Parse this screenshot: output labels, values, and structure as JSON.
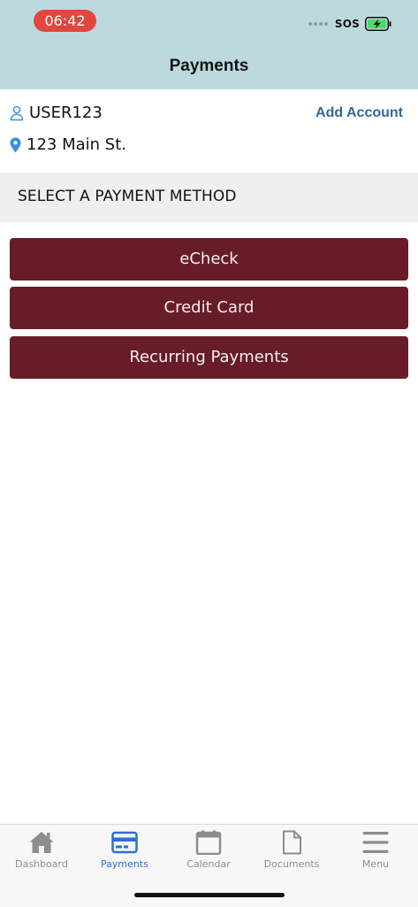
{
  "status_bar": {
    "time": "06:42",
    "carrier": "SOS"
  },
  "header": {
    "title": "Payments"
  },
  "account": {
    "username": "USER123",
    "address": "123 Main St.",
    "add_account_label": "Add Account"
  },
  "section": {
    "title": "SELECT A PAYMENT METHOD"
  },
  "payment_methods": [
    {
      "label": "eCheck"
    },
    {
      "label": "Credit Card"
    },
    {
      "label": "Recurring Payments"
    }
  ],
  "tabbar": {
    "items": [
      {
        "label": "Dashboard",
        "icon": "home-icon"
      },
      {
        "label": "Payments",
        "icon": "credit-card-icon",
        "active": true
      },
      {
        "label": "Calendar",
        "icon": "calendar-icon"
      },
      {
        "label": "Documents",
        "icon": "document-icon"
      },
      {
        "label": "Menu",
        "icon": "hamburger-menu-icon"
      }
    ]
  },
  "colors": {
    "header_bg": "#bcdadd",
    "time_pill": "#e2473f",
    "button_bg": "#681c27",
    "link": "#2f6a9a",
    "tab_active": "#2c6fd3",
    "tab_inactive": "#8c8c8c",
    "battery_fill": "#4cd964"
  }
}
